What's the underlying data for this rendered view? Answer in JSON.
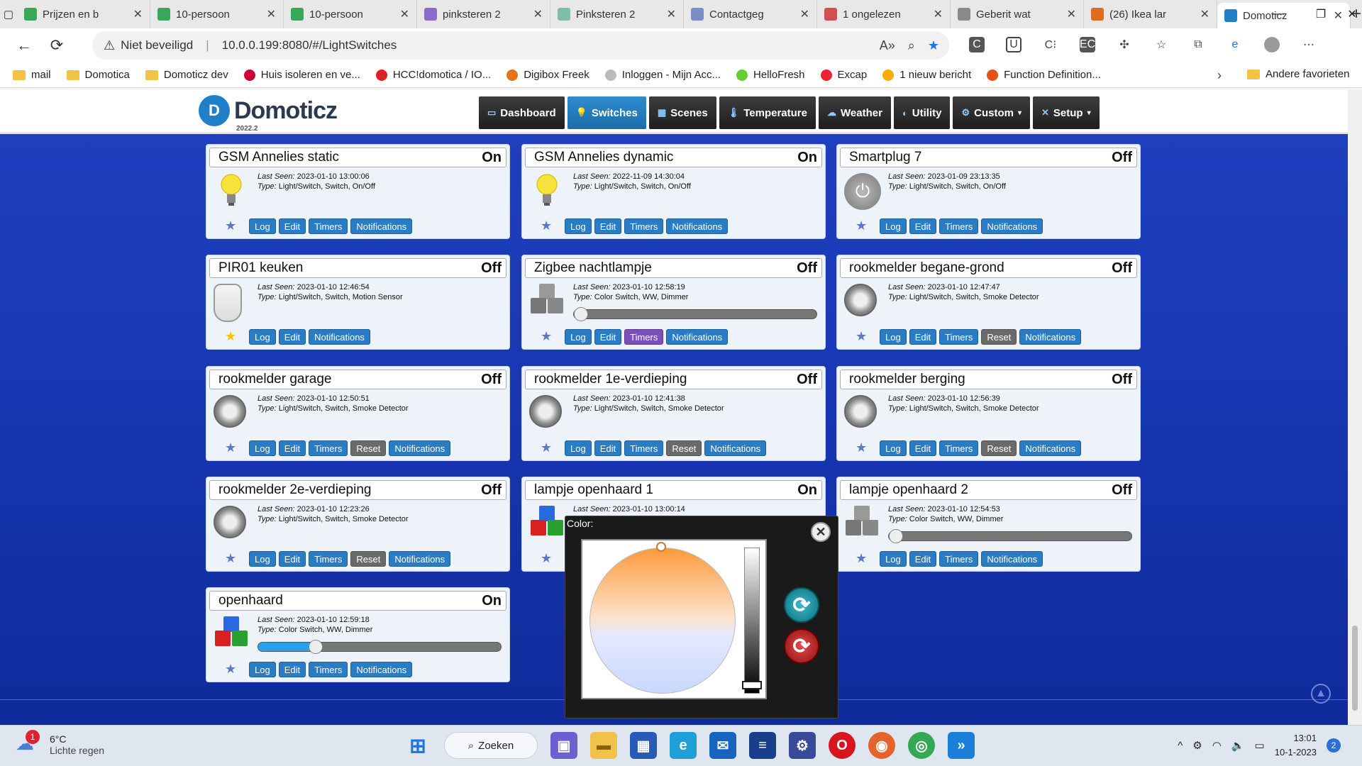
{
  "browser": {
    "tabs": [
      {
        "title": "Prijzen en b",
        "color": "#3aa657"
      },
      {
        "title": "10-persoon",
        "color": "#3aa657"
      },
      {
        "title": "10-persoon",
        "color": "#3aa657"
      },
      {
        "title": "pinksteren 2",
        "color": "#8c6bc8"
      },
      {
        "title": "Pinksteren 2",
        "color": "#7fbfa8"
      },
      {
        "title": "Contactgeg",
        "color": "#7a8fc8"
      },
      {
        "title": "1 ongelezen",
        "color": "#d05050"
      },
      {
        "title": "Geberit wat",
        "color": "#8a8a8a"
      },
      {
        "title": "(26) Ikea lar",
        "color": "#e06a20"
      },
      {
        "title": "Domoticz",
        "color": "#1f7fc8"
      }
    ],
    "security": "Niet beveiligd",
    "url": "10.0.0.199:8080/#/LightSwitches",
    "bookmarks": [
      "mail",
      "Domotica",
      "Domoticz dev",
      "Huis isoleren en ve...",
      "HCC!domotica / IO...",
      "Digibox Freek",
      "Inloggen - Mijn Acc...",
      "HelloFresh",
      "Excap",
      "1 nieuw bericht",
      "Function Definition..."
    ],
    "other_favorites": "Andere favorieten"
  },
  "app": {
    "logo": "Domoticz",
    "version": "2022.2",
    "menu": [
      {
        "label": "Dashboard",
        "icon": "monitor-icon"
      },
      {
        "label": "Switches",
        "icon": "lightbulb-icon"
      },
      {
        "label": "Scenes",
        "icon": "scenes-icon"
      },
      {
        "label": "Temperature",
        "icon": "thermometer-icon"
      },
      {
        "label": "Weather",
        "icon": "cloud-icon"
      },
      {
        "label": "Utility",
        "icon": "utility-icon"
      },
      {
        "label": "Custom",
        "icon": "gear-icon"
      },
      {
        "label": "Setup",
        "icon": "tools-icon"
      }
    ]
  },
  "labels": {
    "last_seen": "Last Seen:",
    "type": "Type:"
  },
  "devices": [
    {
      "name": "GSM Annelies static",
      "status": "On",
      "last_seen": "2023-01-10 13:00:06",
      "type": "Light/Switch, Switch, On/Off",
      "icon": "bulb-on-icon",
      "buttons": [
        "Log",
        "Edit",
        "Timers",
        "Notifications"
      ],
      "favorite": false
    },
    {
      "name": "GSM Annelies dynamic",
      "status": "On",
      "last_seen": "2022-11-09 14:30:04",
      "type": "Light/Switch, Switch, On/Off",
      "icon": "bulb-on-icon",
      "buttons": [
        "Log",
        "Edit",
        "Timers",
        "Notifications"
      ],
      "favorite": false
    },
    {
      "name": "Smartplug 7",
      "status": "Off",
      "last_seen": "2023-01-09 23:13:35",
      "type": "Light/Switch, Switch, On/Off",
      "icon": "power-icon",
      "buttons": [
        "Log",
        "Edit",
        "Timers",
        "Notifications"
      ],
      "favorite": false
    },
    {
      "name": "PIR01 keuken",
      "status": "Off",
      "last_seen": "2023-01-10 12:46:54",
      "type": "Light/Switch, Switch, Motion Sensor",
      "icon": "motion-sensor-icon",
      "buttons": [
        "Log",
        "Edit",
        "Notifications"
      ],
      "favorite": true
    },
    {
      "name": "Zigbee nachtlampje",
      "status": "Off",
      "last_seen": "2023-01-10 12:58:19",
      "type": "Color Switch, WW, Dimmer",
      "icon": "rgb-off-icon",
      "buttons": [
        "Log",
        "Edit",
        "Timers",
        "Notifications"
      ],
      "favorite": false,
      "dimmer": 0
    },
    {
      "name": "rookmelder begane-grond",
      "status": "Off",
      "last_seen": "2023-01-10 12:47:47",
      "type": "Light/Switch, Switch, Smoke Detector",
      "icon": "smoke-detector-icon",
      "buttons": [
        "Log",
        "Edit",
        "Timers",
        "Reset",
        "Notifications"
      ],
      "favorite": false
    },
    {
      "name": "rookmelder garage",
      "status": "Off",
      "last_seen": "2023-01-10 12:50:51",
      "type": "Light/Switch, Switch, Smoke Detector",
      "icon": "smoke-detector-icon",
      "buttons": [
        "Log",
        "Edit",
        "Timers",
        "Reset",
        "Notifications"
      ],
      "favorite": false
    },
    {
      "name": "rookmelder 1e-verdieping",
      "status": "Off",
      "last_seen": "2023-01-10 12:41:38",
      "type": "Light/Switch, Switch, Smoke Detector",
      "icon": "smoke-detector-icon",
      "buttons": [
        "Log",
        "Edit",
        "Timers",
        "Reset",
        "Notifications"
      ],
      "favorite": false
    },
    {
      "name": "rookmelder berging",
      "status": "Off",
      "last_seen": "2023-01-10 12:56:39",
      "type": "Light/Switch, Switch, Smoke Detector",
      "icon": "smoke-detector-icon",
      "buttons": [
        "Log",
        "Edit",
        "Timers",
        "Reset",
        "Notifications"
      ],
      "favorite": false
    },
    {
      "name": "rookmelder 2e-verdieping",
      "status": "Off",
      "last_seen": "2023-01-10 12:23:26",
      "type": "Light/Switch, Switch, Smoke Detector",
      "icon": "smoke-detector-icon",
      "buttons": [
        "Log",
        "Edit",
        "Timers",
        "Reset",
        "Notifications"
      ],
      "favorite": false
    },
    {
      "name": "lampje openhaard 1",
      "status": "On",
      "last_seen": "2023-01-10 13:00:14",
      "type": "",
      "icon": "rgb-on-icon",
      "buttons": [],
      "favorite": false
    },
    {
      "name": "lampje openhaard 2",
      "status": "Off",
      "last_seen": "2023-01-10 12:54:53",
      "type": "Color Switch, WW, Dimmer",
      "icon": "rgb-off-icon",
      "buttons": [
        "Log",
        "Edit",
        "Timers",
        "Notifications"
      ],
      "favorite": false,
      "dimmer": 0
    },
    {
      "name": "openhaard",
      "status": "On",
      "last_seen": "2023-01-10 12:59:18",
      "type": "Color Switch, WW, Dimmer",
      "icon": "rgb-on-icon",
      "buttons": [
        "Log",
        "Edit",
        "Timers",
        "Notifications"
      ],
      "favorite": false,
      "dimmer": 0.22
    }
  ],
  "color_popup": {
    "label": "Color:"
  },
  "taskbar": {
    "temperature": "6°C",
    "weather": "Lichte regen",
    "weather_badge": "1",
    "search": "Zoeken",
    "time": "13:01",
    "date": "10-1-2023",
    "notifications": "2"
  }
}
